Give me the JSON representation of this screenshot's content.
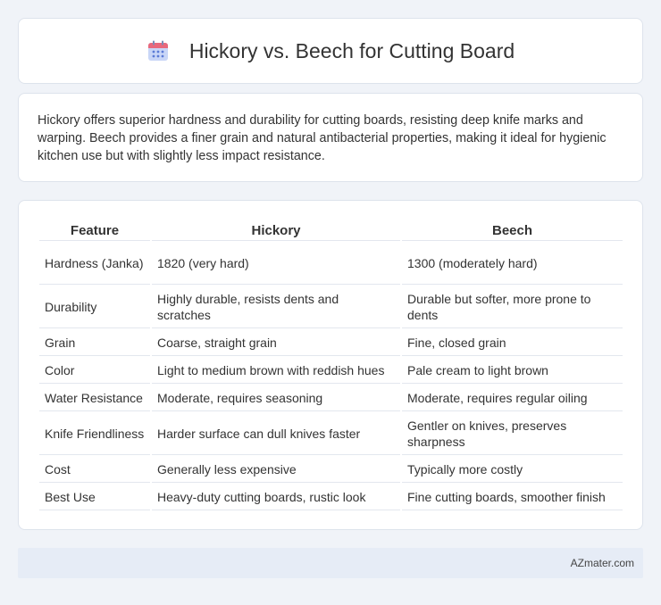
{
  "header": {
    "title": "Hickory vs. Beech for Cutting Board",
    "icon": "calendar-icon",
    "icon_colors": {
      "top": "#e8697d",
      "body": "#c9d6f7",
      "dots": "#5b7bd6"
    }
  },
  "intro": {
    "text": "Hickory offers superior hardness and durability for cutting boards, resisting deep knife marks and warping. Beech provides a finer grain and natural antibacterial properties, making it ideal for hygienic kitchen use but with slightly less impact resistance."
  },
  "table": {
    "headers": [
      "Feature",
      "Hickory",
      "Beech"
    ],
    "rows": [
      {
        "feature": "Hardness (Janka)",
        "hickory": "1820 (very hard)",
        "beech": "1300 (moderately hard)"
      },
      {
        "feature": "Durability",
        "hickory": "Highly durable, resists dents and scratches",
        "beech": "Durable but softer, more prone to dents"
      },
      {
        "feature": "Grain",
        "hickory": "Coarse, straight grain",
        "beech": "Fine, closed grain"
      },
      {
        "feature": "Color",
        "hickory": "Light to medium brown with reddish hues",
        "beech": "Pale cream to light brown"
      },
      {
        "feature": "Water Resistance",
        "hickory": "Moderate, requires seasoning",
        "beech": "Moderate, requires regular oiling"
      },
      {
        "feature": "Knife Friendliness",
        "hickory": "Harder surface can dull knives faster",
        "beech": "Gentler on knives, preserves sharpness"
      },
      {
        "feature": "Cost",
        "hickory": "Generally less expensive",
        "beech": "Typically more costly"
      },
      {
        "feature": "Best Use",
        "hickory": "Heavy-duty cutting boards, rustic look",
        "beech": "Fine cutting boards, smoother finish"
      }
    ]
  },
  "footer": {
    "brand": "AZmater.com"
  }
}
